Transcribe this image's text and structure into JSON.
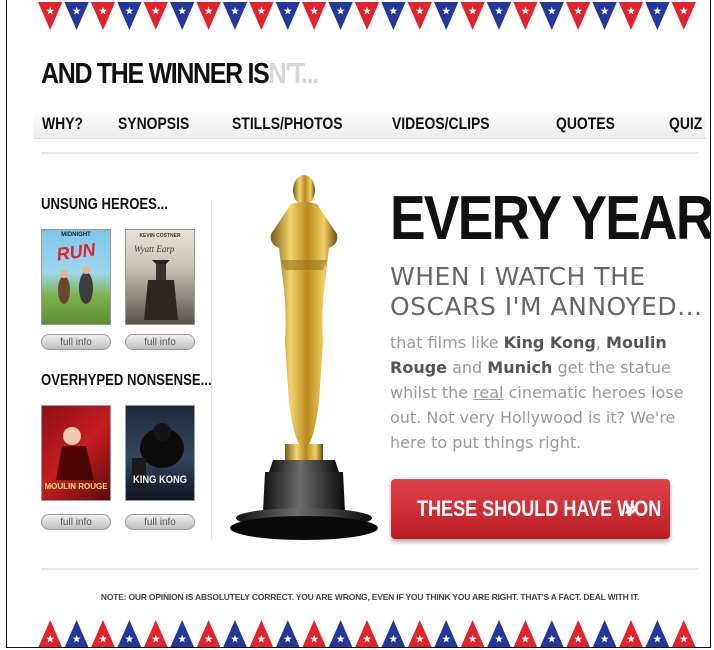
{
  "brand": {
    "main": "AND THE WINNER IS",
    "faded": "N'T..."
  },
  "nav": [
    {
      "label": "WHY?",
      "active": true
    },
    {
      "label": "SYNOPSIS",
      "active": false
    },
    {
      "label": "STILLS/PHOTOS",
      "active": true
    },
    {
      "label": "VIDEOS/CLIPS",
      "active": false
    },
    {
      "label": "QUOTES",
      "active": true
    },
    {
      "label": "QUIZ",
      "active": false
    }
  ],
  "sidebar": {
    "unsung_heading": "UNSUNG HEROES...",
    "overhyped_heading": "OVERHYPED NONSENSE...",
    "unsung": [
      {
        "poster_title": "RUN",
        "poster_super": "MIDNIGHT",
        "button": "full info"
      },
      {
        "poster_title": "",
        "poster_super": "KEVIN COSTNER",
        "button": "full info"
      }
    ],
    "overhyped": [
      {
        "poster_title": "MOULIN ROUGE",
        "button": "full info"
      },
      {
        "poster_title": "KING KONG",
        "button": "full info"
      }
    ]
  },
  "hero": {
    "headline": "EVERY YEAR",
    "subhead_line1": "WHEN I WATCH THE",
    "subhead_line2": "OSCARS I'M ANNOYED...",
    "body": {
      "p1": "that films like ",
      "film1": "King Kong",
      "p2": ", ",
      "film2": "Moulin Rouge",
      "p3": " and ",
      "film3": "Munich",
      "p4": " get the statue whilst the ",
      "emph": "real",
      "p5": " cinematic heroes lose out. Not very Hollywood is it? We're here to put things right."
    },
    "cta_label": "THESE SHOULD HAVE WON",
    "cta_arrow": "»"
  },
  "footer_note": "NOTE: OUR OPINION IS ABSOLUTELY CORRECT. YOU ARE WRONG, EVEN IF YOU THINK YOU ARE RIGHT. THAT'S A FACT. DEAL WITH IT.",
  "colors": {
    "accent_red": "#e0242b",
    "flag_blue": "#24379b",
    "cta_red": "#c8262d"
  },
  "icons": {
    "bunting": "stars-pennant-bunting",
    "statue": "oscar-statuette-icon"
  }
}
